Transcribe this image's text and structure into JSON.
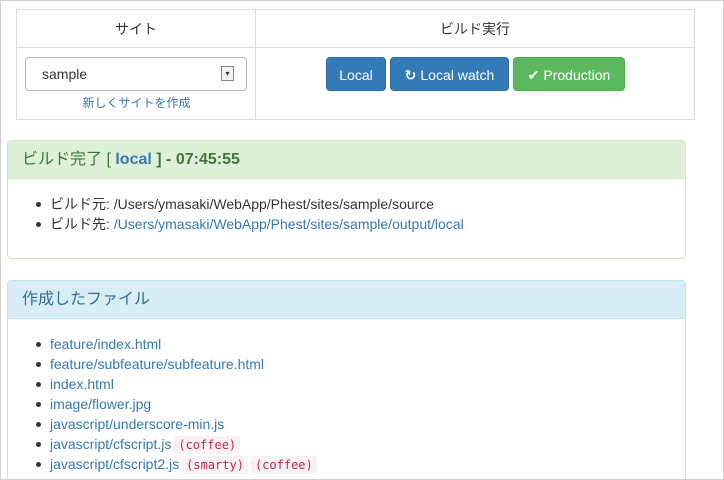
{
  "table": {
    "header_site": "サイト",
    "header_build": "ビルド実行",
    "site_select_value": "sample",
    "new_site_link": "新しくサイトを作成"
  },
  "buttons": {
    "local": "Local",
    "local_watch": "Local watch",
    "production": "Production",
    "local_watch_icon": "refresh-icon",
    "production_icon": "check-icon"
  },
  "build_panel": {
    "title_prefix": "ビルド完了 [",
    "target": "local",
    "title_suffix": "] - 07:45:55",
    "source_label": "ビルド元:",
    "source_path": "/Users/ymasaki/WebApp/Phest/sites/sample/source",
    "output_label": "ビルド先:",
    "output_path": "/Users/ymasaki/WebApp/Phest/sites/sample/output/local"
  },
  "files_panel": {
    "title": "作成したファイル",
    "files": [
      {
        "name": "feature/index.html",
        "tags": []
      },
      {
        "name": "feature/subfeature/subfeature.html",
        "tags": []
      },
      {
        "name": "index.html",
        "tags": []
      },
      {
        "name": "image/flower.jpg",
        "tags": []
      },
      {
        "name": "javascript/underscore-min.js",
        "tags": []
      },
      {
        "name": "javascript/cfscript.js",
        "tags": [
          "(coffee)"
        ]
      },
      {
        "name": "javascript/cfscript2.js",
        "tags": [
          "(smarty)",
          "(coffee)"
        ]
      }
    ]
  },
  "colors": {
    "primary": "#337ab7",
    "success": "#5cb85c",
    "success_bg": "#dff0d8",
    "info_bg": "#d9edf7"
  }
}
